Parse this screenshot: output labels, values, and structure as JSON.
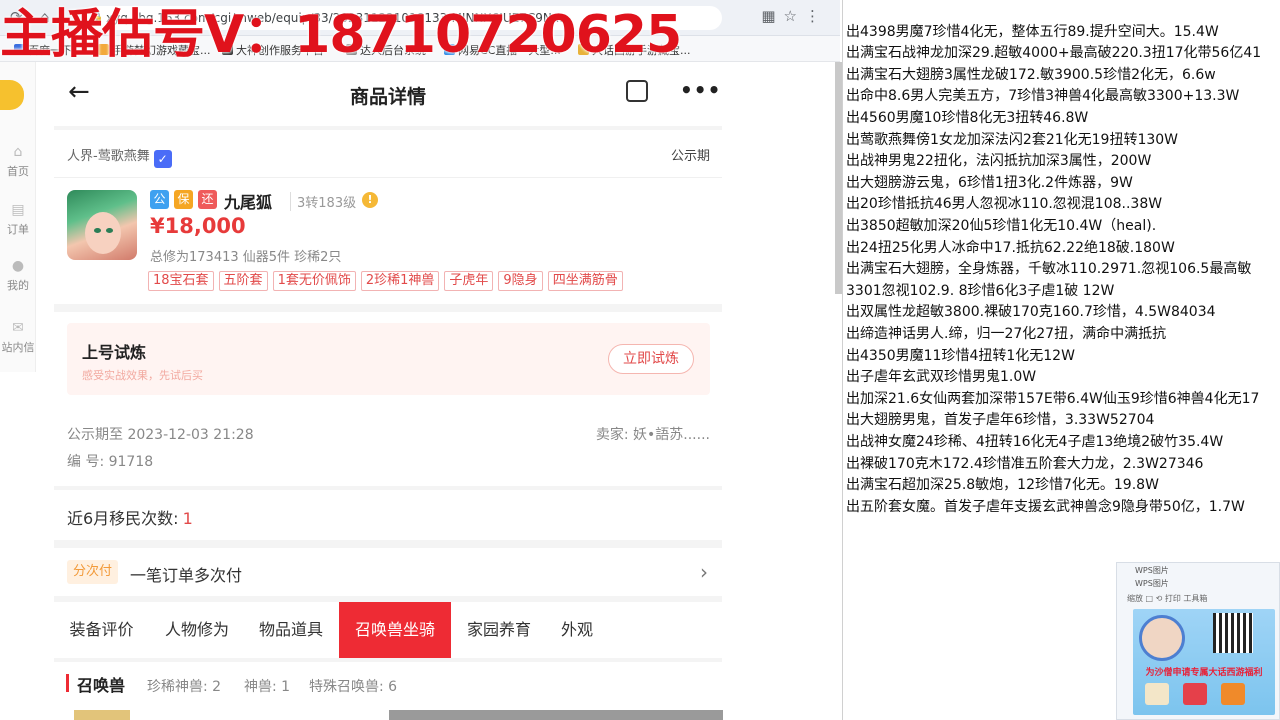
{
  "overlay": {
    "text": "主播估号V：18710720625"
  },
  "browser": {
    "url": "xyq.cbg.163.com/cgi/mweb/equip/33/202311221018133-MINNX6IUE7C9N...",
    "bookmarks": [
      "百度一下",
      "手游梦幻游戏藏宝...",
      "大神创作服务平台",
      "达人后台系统",
      "网易CC直播 - 大型...",
      "大话西游手游藏宝..."
    ]
  },
  "sidebar": {
    "items": [
      "首页",
      "订单",
      "我的",
      "站内信"
    ]
  },
  "header": {
    "title": "商品详情"
  },
  "product": {
    "server": "人界-莺歌燕舞",
    "status": "公示期",
    "tags": [
      "公",
      "保",
      "还"
    ],
    "name": "九尾狐",
    "level": "3转183级",
    "price": "¥18,000",
    "meta": "总修为173413  仙器5件  珍稀2只",
    "chips": [
      "18宝石套",
      "五阶套",
      "1套无价佩饰",
      "2珍稀1神兽",
      "子虎年",
      "9隐身",
      "四坐满筋骨"
    ]
  },
  "trial": {
    "title": "上号试炼",
    "subtitle": "感受实战效果，先试后买",
    "button": "立即试炼"
  },
  "publicity": {
    "until": "公示期至 2023-12-03 21:28",
    "seller": "卖家: 妖•語苏......",
    "serial": "编 号: 91718"
  },
  "migration": {
    "label": "近6月移民次数:",
    "count": "1"
  },
  "installment": {
    "badge": "分次付",
    "text": "一笔订单多次付"
  },
  "tabs": [
    {
      "label": "装备评价"
    },
    {
      "label": "人物修为"
    },
    {
      "label": "物品道具"
    },
    {
      "label": "召唤兽坐骑"
    },
    {
      "label": "家园养育"
    },
    {
      "label": "外观"
    }
  ],
  "pets": {
    "title": "召唤兽",
    "stats": [
      "珍稀神兽: 2",
      "神兽: 1",
      "特殊召唤兽: 6"
    ]
  },
  "notes": [
    "出4398男魔7珍惜4化无，整体五行89.提升空间大。15.4W",
    "出满宝石战神龙加深29.超敏4000+最高破220.3扭17化带56亿41",
    "出满宝石大翅膀3属性龙破172.敏3900.5珍惜2化无，6.6w",
    "出命中8.6男人完美五方，7珍惜3神兽4化最高敏3300+13.3W",
    "出4560男魔10珍惜8化无3扭转46.8W",
    "出莺歌燕舞傍1女龙加深法闪2套21化无19扭转130W",
    "出战神男鬼22扭化，法闪抵抗加深3属性，200W",
    "出大翅膀游云鬼，6珍惜1扭3化.2件炼器，9W",
    "出20珍惜抵抗46男人忽视冰110.忽视混108..38W",
    "出3850超敏加深20仙5珍惜1化无10.4W（heal).",
    "出24扭25化男人冰命中17.抵抗62.22绝18破.180W",
    "出满宝石大翅膀，全身炼器，千敏冰110.2971.忽视106.5最高敏",
    "3301忽视102.9. 8珍惜6化3子虐1破   12W",
    "出双属性龙超敏3800.裸破170克160.7珍惜，4.5W84034",
    "出缔造神话男人.缔，归一27化27扭，满命中满抵抗",
    "出4350男魔11珍惜4扭转1化无12W",
    "出子虐年玄武双珍惜男鬼1.0W",
    "出加深21.6女仙两套加深带157E带6.4W仙玉9珍惜6神兽4化无17",
    "出大翅膀男鬼，首发子虐年6珍惜，3.33W52704",
    "出战神女魔24珍稀、4扭转16化无4子虐13绝境2破竹35.4W",
    "出裸破170克木172.4珍惜准五阶套大力龙，2.3W27346",
    "出满宝石超加深25.8敏炮，12珍惜7化无。19.8W",
    "出五阶套女魔。首发子虐年支援玄武神兽念9隐身带50亿，1.7W"
  ],
  "widget": {
    "title1": "WPS图片",
    "title2": "WPS图片",
    "tools": "缩放  □  ⟲  打印  工具箱",
    "ad_text": "为沙僧申请专属大话西游福利"
  },
  "colors": {
    "accent": "#ee2b34",
    "price": "#e73a3a",
    "overlay": "#e0121c"
  }
}
